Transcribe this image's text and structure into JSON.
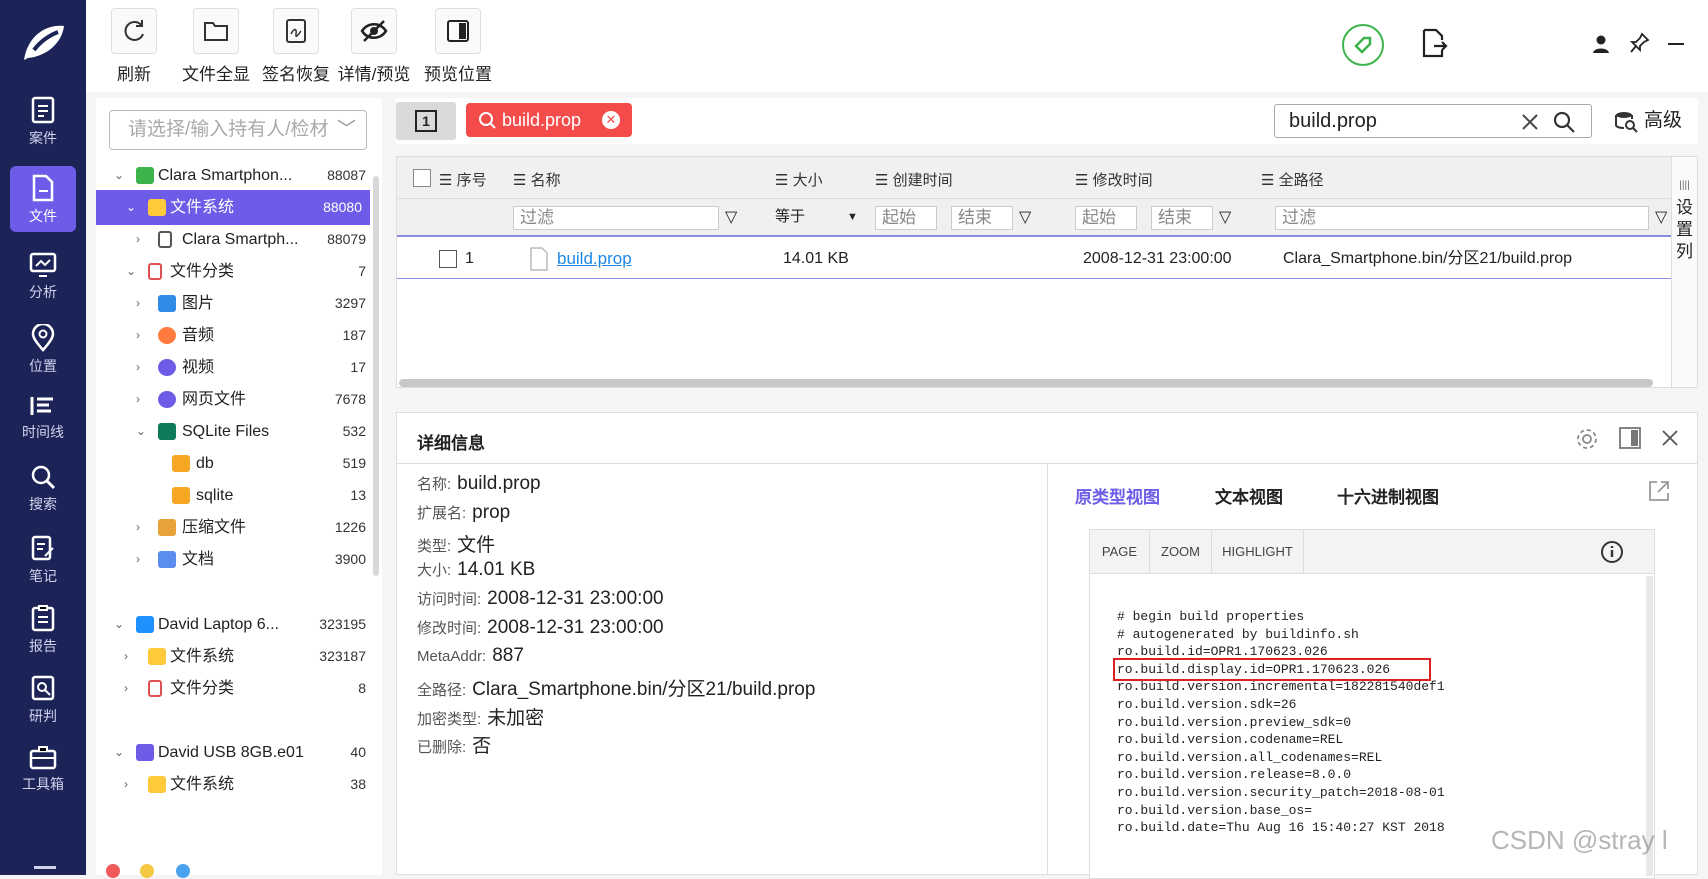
{
  "toolbar": {
    "refresh": "刷新",
    "show_all": "文件全显",
    "sig_restore": "签名恢复",
    "detail_preview": "详情/预览",
    "preview_pos": "预览位置"
  },
  "nav": [
    "案件",
    "文件",
    "分析",
    "位置",
    "时间线",
    "搜索",
    "笔记",
    "报告",
    "研判",
    "工具箱"
  ],
  "owner_placeholder": "请选择/输入持有人/检材",
  "tree": [
    {
      "label": "Clara Smartphon...",
      "count": "88087"
    },
    {
      "label": "文件系统",
      "count": "88080"
    },
    {
      "label": "Clara Smartph...",
      "count": "88079"
    },
    {
      "label": "文件分类",
      "count": "7"
    },
    {
      "label": "图片",
      "count": "3297"
    },
    {
      "label": "音频",
      "count": "187"
    },
    {
      "label": "视频",
      "count": "17"
    },
    {
      "label": "网页文件",
      "count": "7678"
    },
    {
      "label": "SQLite Files",
      "count": "532"
    },
    {
      "label": "db",
      "count": "519"
    },
    {
      "label": "sqlite",
      "count": "13"
    },
    {
      "label": "压缩文件",
      "count": "1226"
    },
    {
      "label": "文档",
      "count": "3900"
    },
    {
      "label": "David Laptop 6...",
      "count": "323195"
    },
    {
      "label": "文件系统",
      "count": "323187"
    },
    {
      "label": "文件分类",
      "count": "8"
    },
    {
      "label": "David USB 8GB.e01",
      "count": "40"
    },
    {
      "label": "文件系统",
      "count": "38"
    }
  ],
  "tab_index": "1",
  "search_tag": "build.prop",
  "search_value": "build.prop",
  "advanced": "高级",
  "columns": {
    "seq": "序号",
    "name": "名称",
    "size": "大小",
    "created": "创建时间",
    "modified": "修改时间",
    "path": "全路径"
  },
  "filters": {
    "filter": "过滤",
    "equals": "等于",
    "start": "起始",
    "end": "结束"
  },
  "settings_col": "设置列",
  "row": {
    "seq": "1",
    "name": "build.prop",
    "size": "14.01 KB",
    "modified": "2008-12-31 23:00:00",
    "path": "Clara_Smartphone.bin/分区21/build.prop"
  },
  "detail": {
    "title": "详细信息",
    "fields": [
      {
        "k": "名称:",
        "v": "build.prop"
      },
      {
        "k": "扩展名:",
        "v": "prop"
      },
      {
        "k": "类型:",
        "v": "文件"
      },
      {
        "k": "大小:",
        "v": "14.01 KB"
      },
      {
        "k": "访问时间:",
        "v": "2008-12-31 23:00:00"
      },
      {
        "k": "修改时间:",
        "v": "2008-12-31 23:00:00"
      },
      {
        "k": "MetaAddr:",
        "v": "887"
      },
      {
        "k": "全路径:",
        "v": "Clara_Smartphone.bin/分区21/build.prop"
      },
      {
        "k": "加密类型:",
        "v": "未加密"
      },
      {
        "k": "已删除:",
        "v": "否"
      }
    ],
    "views": {
      "raw": "原类型视图",
      "text": "文本视图",
      "hex": "十六进制视图"
    },
    "pv_tabs": {
      "page": "PAGE",
      "zoom": "ZOOM",
      "highlight": "HIGHLIGHT"
    },
    "code": [
      "# begin build properties",
      "# autogenerated by buildinfo.sh",
      "ro.build.id=OPR1.170623.026",
      "ro.build.display.id=OPR1.170623.026",
      "ro.build.version.incremental=182281540def1",
      "ro.build.version.sdk=26",
      "ro.build.version.preview_sdk=0",
      "ro.build.version.codename=REL",
      "ro.build.version.all_codenames=REL",
      "ro.build.version.release=8.0.0",
      "ro.build.version.security_patch=2018-08-01",
      "ro.build.version.base_os=",
      "ro.build.date=Thu Aug 16 15:40:27 KST 2018"
    ]
  },
  "watermark": "CSDN @stray l",
  "colors": {
    "nav": "#1b2357",
    "accent": "#6c5ce7",
    "tag": "#f44b4b",
    "highlight_box": "#e02020"
  }
}
